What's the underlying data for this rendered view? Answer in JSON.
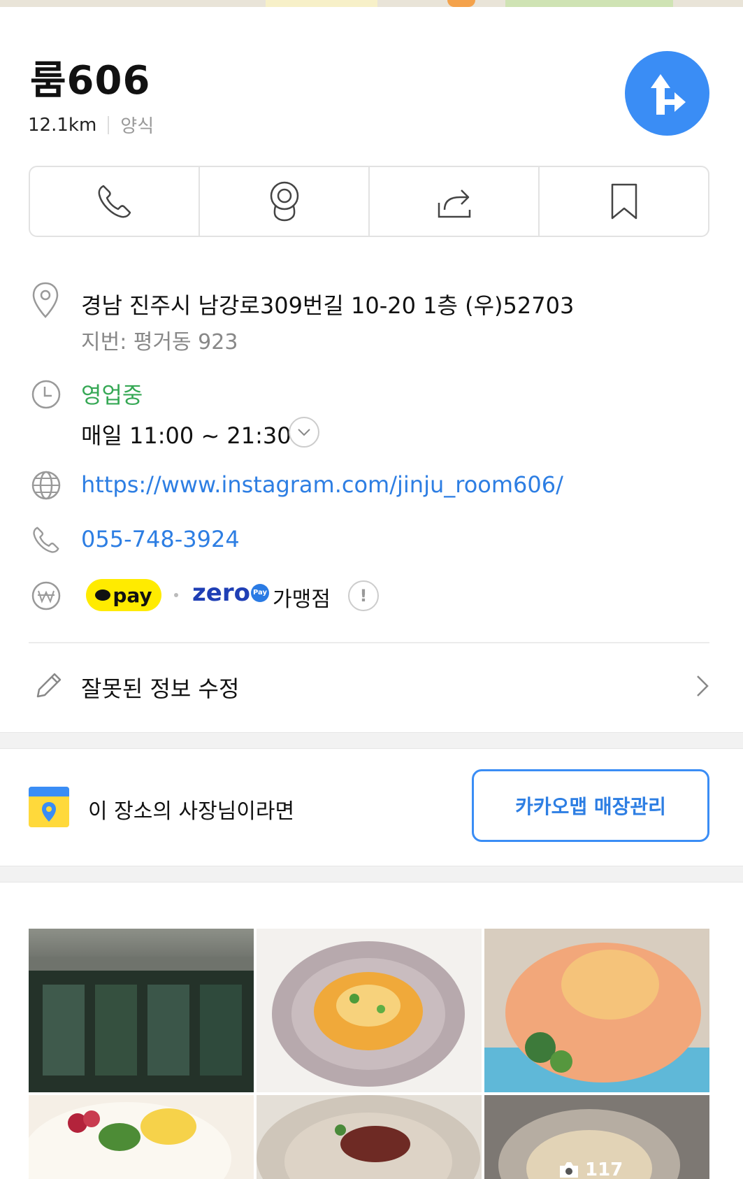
{
  "place": {
    "name": "룸606",
    "distance": "12.1km",
    "category": "양식"
  },
  "info": {
    "address": "경남 진주시 남강로309번길 10-20 1층 (우)52703",
    "lot_address": "지번: 평거동 923",
    "status": "영업중",
    "hours": "매일 11:00 ~ 21:30",
    "website": "https://www.instagram.com/jinju_room606/",
    "phone": "055-748-3924",
    "kakaopay_label": "pay",
    "zeropay_label": "zero",
    "zeropay_badge": "Pay",
    "merchant_label": "가맹점",
    "notice_symbol": "!"
  },
  "edit": {
    "label": "잘못된 정보 수정"
  },
  "owner": {
    "text": "이 장소의 사장님이라면",
    "button": "카카오맵 매장관리"
  },
  "photos": {
    "count_label": "117"
  },
  "colors": {
    "accent": "#3a8df5",
    "open_status": "#36a855",
    "link": "#2d7ee3",
    "kakaopay": "#ffeb00",
    "zeropay": "#1f3fb5"
  }
}
